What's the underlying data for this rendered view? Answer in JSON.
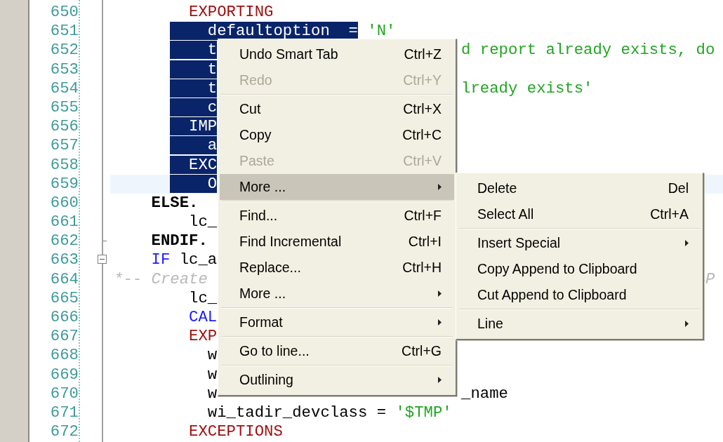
{
  "editor": {
    "lines": [
      {
        "number": "650",
        "segments": [
          {
            "kind": "keyword",
            "text": "        EXPORTING"
          }
        ]
      },
      {
        "number": "651",
        "segments": [
          {
            "kind": "selected",
            "text": "    defaultoption  ="
          },
          {
            "kind": "string",
            "text": " 'N'"
          }
        ]
      },
      {
        "number": "652",
        "segments": [
          {
            "kind": "selected",
            "text": "    t"
          },
          {
            "kind": "string",
            "text": "                          d report already exists, do"
          }
        ]
      },
      {
        "number": "653",
        "segments": [
          {
            "kind": "selected",
            "text": "    t"
          }
        ]
      },
      {
        "number": "654",
        "segments": [
          {
            "kind": "selected",
            "text": "    t"
          },
          {
            "kind": "string",
            "text": "                          lready exists'"
          }
        ]
      },
      {
        "number": "655",
        "segments": [
          {
            "kind": "selected",
            "text": "    c"
          }
        ]
      },
      {
        "number": "656",
        "segments": [
          {
            "kind": "selected",
            "text": "  IMP"
          }
        ]
      },
      {
        "number": "657",
        "segments": [
          {
            "kind": "selected",
            "text": "    a"
          }
        ]
      },
      {
        "number": "658",
        "segments": [
          {
            "kind": "selected",
            "text": "  EXC"
          }
        ]
      },
      {
        "number": "659",
        "current": true,
        "segments": [
          {
            "kind": "selected",
            "text": "    O"
          }
        ]
      },
      {
        "number": "660",
        "segments": [
          {
            "kind": "statement",
            "text": "    ELSE."
          }
        ]
      },
      {
        "number": "661",
        "segments": [
          {
            "kind": "plain",
            "text": "        lc_"
          }
        ]
      },
      {
        "number": "662",
        "fold_end": true,
        "segments": [
          {
            "kind": "statement",
            "text": "    ENDIF."
          }
        ]
      },
      {
        "number": "663",
        "fold_open": true,
        "segments": [
          {
            "kind": "control",
            "text": "    IF"
          },
          {
            "kind": "plain",
            "text": " lc_a"
          }
        ]
      },
      {
        "number": "664",
        "segments": [
          {
            "kind": "comment",
            "text": "*-- Create"
          },
          {
            "kind": "comment",
            "text": "                                                     P"
          }
        ]
      },
      {
        "number": "665",
        "segments": [
          {
            "kind": "plain",
            "text": "        lc_"
          }
        ]
      },
      {
        "number": "666",
        "segments": [
          {
            "kind": "control",
            "text": "        CAL"
          }
        ]
      },
      {
        "number": "667",
        "segments": [
          {
            "kind": "keyword",
            "text": "        EXP"
          }
        ]
      },
      {
        "number": "668",
        "segments": [
          {
            "kind": "plain",
            "text": "          w"
          }
        ]
      },
      {
        "number": "669",
        "segments": [
          {
            "kind": "plain",
            "text": "          w"
          }
        ]
      },
      {
        "number": "670",
        "segments": [
          {
            "kind": "plain",
            "text": "          w"
          },
          {
            "kind": "plain",
            "text": "                          _name"
          }
        ]
      },
      {
        "number": "671",
        "segments": [
          {
            "kind": "plain",
            "text": "          wi_tadir_devclass ="
          },
          {
            "kind": "string",
            "text": " '$TMP'"
          }
        ]
      },
      {
        "number": "672",
        "segments": [
          {
            "kind": "keyword",
            "text": "        EXCEPTIONS"
          }
        ]
      }
    ]
  },
  "context_menu": {
    "items": [
      {
        "kind": "item",
        "label": "Undo Smart Tab",
        "shortcut": "Ctrl+Z",
        "disabled": false,
        "selected": false,
        "submenu": false
      },
      {
        "kind": "item",
        "label": "Redo",
        "shortcut": "Ctrl+Y",
        "disabled": true,
        "selected": false,
        "submenu": false
      },
      {
        "kind": "separator"
      },
      {
        "kind": "item",
        "label": "Cut",
        "shortcut": "Ctrl+X",
        "disabled": false,
        "selected": false,
        "submenu": false
      },
      {
        "kind": "item",
        "label": "Copy",
        "shortcut": "Ctrl+C",
        "disabled": false,
        "selected": false,
        "submenu": false
      },
      {
        "kind": "item",
        "label": "Paste",
        "shortcut": "Ctrl+V",
        "disabled": true,
        "selected": false,
        "submenu": false
      },
      {
        "kind": "item",
        "label": "More ...",
        "disabled": false,
        "selected": true,
        "submenu": true
      },
      {
        "kind": "separator"
      },
      {
        "kind": "item",
        "label": "Find...",
        "shortcut": "Ctrl+F",
        "disabled": false,
        "selected": false,
        "submenu": false
      },
      {
        "kind": "item",
        "label": "Find Incremental",
        "shortcut": "Ctrl+I",
        "disabled": false,
        "selected": false,
        "submenu": false
      },
      {
        "kind": "item",
        "label": "Replace...",
        "shortcut": "Ctrl+H",
        "disabled": false,
        "selected": false,
        "submenu": false
      },
      {
        "kind": "item",
        "label": "More ...",
        "disabled": false,
        "selected": false,
        "submenu": true
      },
      {
        "kind": "separator"
      },
      {
        "kind": "item",
        "label": "Format",
        "disabled": false,
        "selected": false,
        "submenu": true
      },
      {
        "kind": "separator"
      },
      {
        "kind": "item",
        "label": "Go to line...",
        "shortcut": "Ctrl+G",
        "disabled": false,
        "selected": false,
        "submenu": false
      },
      {
        "kind": "separator"
      },
      {
        "kind": "item",
        "label": "Outlining",
        "disabled": false,
        "selected": false,
        "submenu": true
      }
    ]
  },
  "submenu": {
    "items": [
      {
        "kind": "item",
        "label": "Delete",
        "shortcut": "Del",
        "disabled": false,
        "selected": false,
        "submenu": false
      },
      {
        "kind": "item",
        "label": "Select All",
        "shortcut": "Ctrl+A",
        "disabled": false,
        "selected": false,
        "submenu": false
      },
      {
        "kind": "separator"
      },
      {
        "kind": "item",
        "label": "Insert Special",
        "disabled": false,
        "selected": false,
        "submenu": true
      },
      {
        "kind": "item",
        "label": "Copy Append to Clipboard",
        "disabled": false,
        "selected": false,
        "submenu": false
      },
      {
        "kind": "item",
        "label": "Cut Append to Clipboard",
        "disabled": false,
        "selected": false,
        "submenu": false
      },
      {
        "kind": "separator"
      },
      {
        "kind": "item",
        "label": "Line",
        "disabled": false,
        "selected": false,
        "submenu": true
      }
    ]
  }
}
